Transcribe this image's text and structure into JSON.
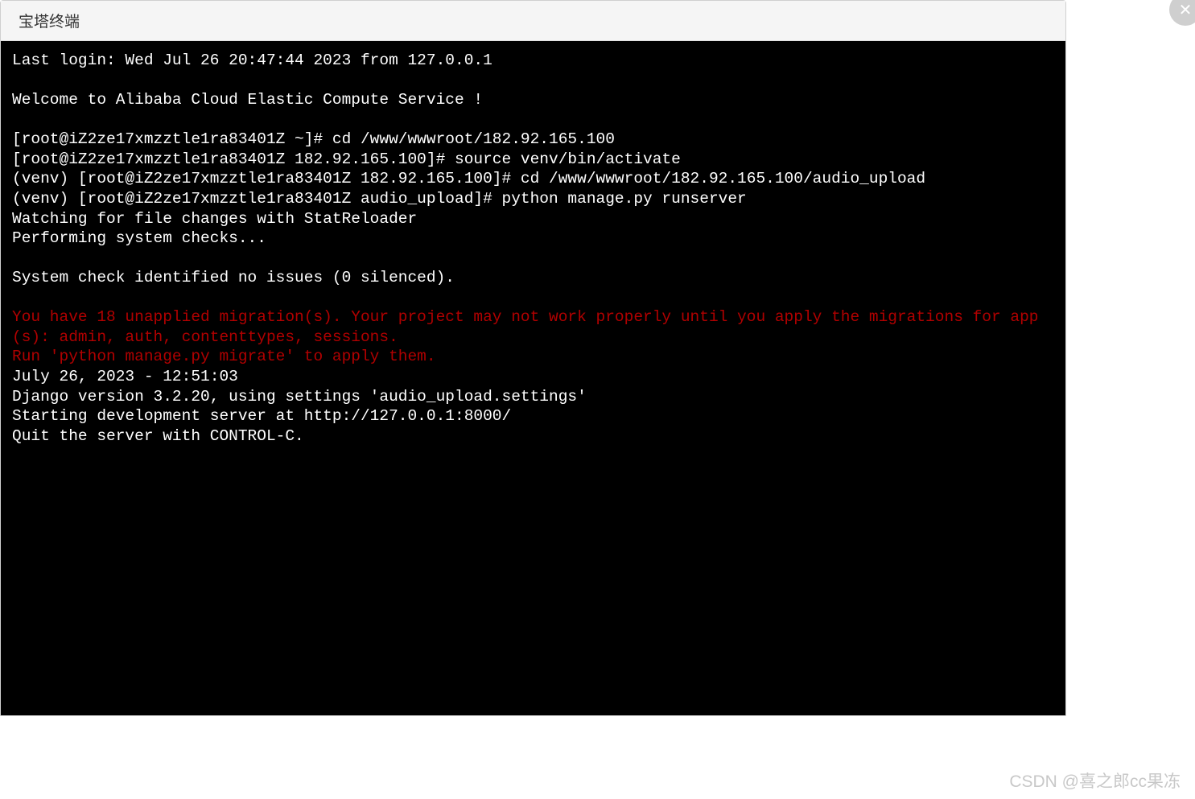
{
  "titlebar": {
    "title": "宝塔终端"
  },
  "close": {
    "glyph": "✕"
  },
  "terminal": {
    "lines": [
      {
        "t": "Last login: Wed Jul 26 20:47:44 2023 from 127.0.0.1",
        "c": "w"
      },
      {
        "t": "",
        "c": "w"
      },
      {
        "t": "Welcome to Alibaba Cloud Elastic Compute Service !",
        "c": "w"
      },
      {
        "t": "",
        "c": "w"
      },
      {
        "t": "[root@iZ2ze17xmzztle1ra83401Z ~]# cd /www/wwwroot/182.92.165.100",
        "c": "w"
      },
      {
        "t": "[root@iZ2ze17xmzztle1ra83401Z 182.92.165.100]# source venv/bin/activate",
        "c": "w"
      },
      {
        "t": "(venv) [root@iZ2ze17xmzztle1ra83401Z 182.92.165.100]# cd /www/wwwroot/182.92.165.100/audio_upload",
        "c": "w"
      },
      {
        "t": "(venv) [root@iZ2ze17xmzztle1ra83401Z audio_upload]# python manage.py runserver",
        "c": "w"
      },
      {
        "t": "Watching for file changes with StatReloader",
        "c": "w"
      },
      {
        "t": "Performing system checks...",
        "c": "w"
      },
      {
        "t": "",
        "c": "w"
      },
      {
        "t": "System check identified no issues (0 silenced).",
        "c": "w"
      },
      {
        "t": "",
        "c": "w"
      },
      {
        "t": "You have 18 unapplied migration(s). Your project may not work properly until you apply the migrations for app(s): admin, auth, contenttypes, sessions.",
        "c": "r"
      },
      {
        "t": "Run 'python manage.py migrate' to apply them.",
        "c": "r"
      },
      {
        "t": "July 26, 2023 - 12:51:03",
        "c": "w"
      },
      {
        "t": "Django version 3.2.20, using settings 'audio_upload.settings'",
        "c": "w"
      },
      {
        "t": "Starting development server at http://127.0.0.1:8000/",
        "c": "w"
      },
      {
        "t": "Quit the server with CONTROL-C.",
        "c": "w"
      }
    ]
  },
  "watermark": {
    "text": "CSDN @喜之郎cc果冻"
  }
}
